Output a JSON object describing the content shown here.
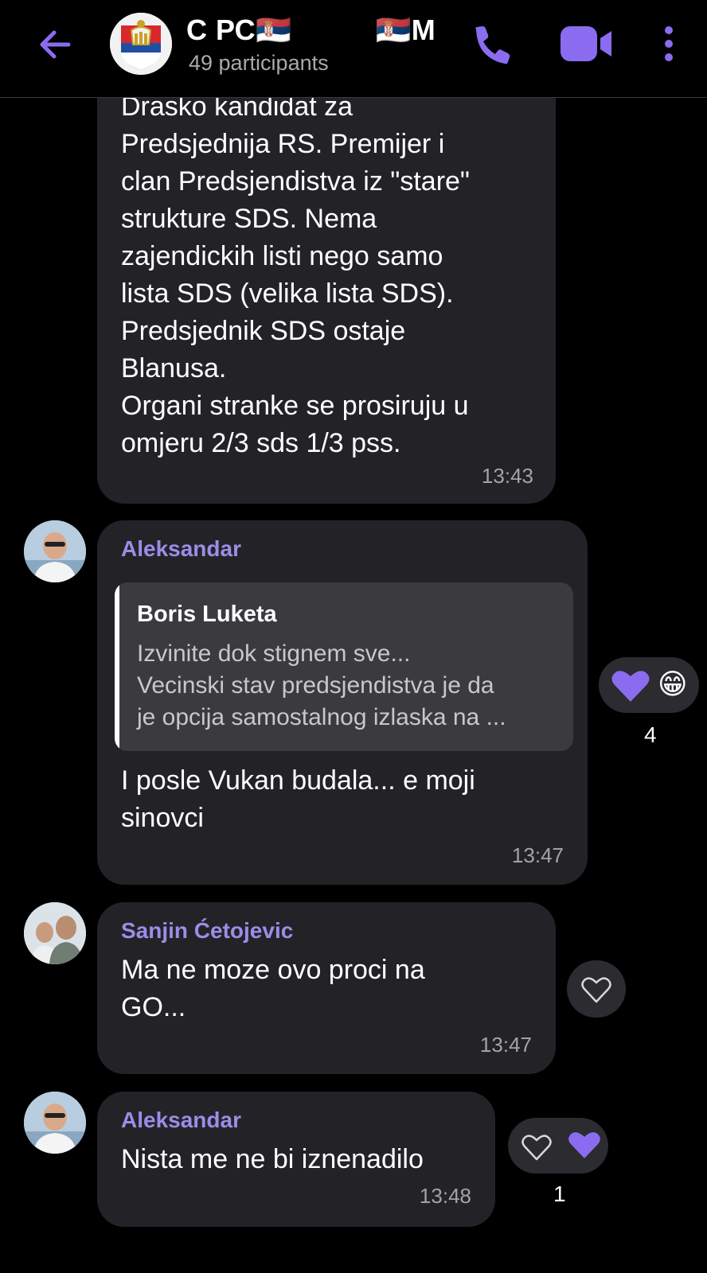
{
  "header": {
    "title": "С РС🇷🇸          🇷🇸М",
    "participants": "49 participants",
    "icons": {
      "back": "arrow-left-icon",
      "call": "phone-icon",
      "video": "video-camera-icon",
      "more": "more-vertical-icon"
    },
    "accent": "#8b6cf0"
  },
  "messages": [
    {
      "text": "Drasko kandidat za\nPredsjednija RS. Premijer i\nclan Predsjendistva iz \"stare\"\nstrukture SDS. Nema\nzajendickih listi nego samo\nlista SDS (velika lista SDS).\nPredsjednik SDS ostaje\nBlanusa.\nOrgani stranke se prosiruju u\nomjeru 2/3 sds 1/3 pss.",
      "time": "13:43"
    },
    {
      "sender": "Aleksandar",
      "quote": {
        "author": "Boris Luketa",
        "text": "Izvinite dok stignem sve...\nVecinski stav predsjendistva je da\nje opcija samostalnog izlaska na ..."
      },
      "text": "I posle Vukan budala... e moji\nsinovci",
      "time": "13:47",
      "reactions": {
        "count": "4",
        "emojis": [
          "heart",
          "😁"
        ]
      }
    },
    {
      "sender": "Sanjin Ćetojevic",
      "text": "Ma ne moze ovo proci na\nGO...",
      "time": "13:47"
    },
    {
      "sender": "Aleksandar",
      "text": "Nista me ne bi iznenadilo",
      "time": "13:48",
      "reactions": {
        "count": "1"
      }
    }
  ]
}
